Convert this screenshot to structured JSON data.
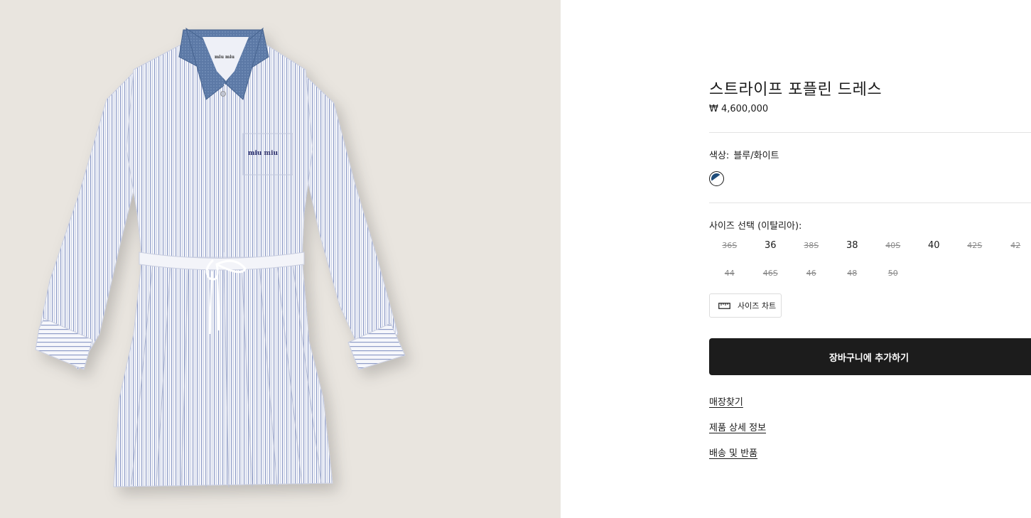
{
  "product": {
    "title": "스트라이프 포플린 드레스",
    "price": "₩ 4,600,000",
    "image_alt": "product-photo-striped-poplin-dress",
    "logo_text": "miu miu"
  },
  "color": {
    "label": "색상:",
    "value": "블루/화이트",
    "swatch_colors": [
      "#1e4d7b",
      "#ffffff"
    ]
  },
  "size": {
    "label": "사이즈 선택 (이탈리아):",
    "options": [
      {
        "label": "36S",
        "available": false
      },
      {
        "label": "36",
        "available": true
      },
      {
        "label": "38S",
        "available": false
      },
      {
        "label": "38",
        "available": true
      },
      {
        "label": "40S",
        "available": false
      },
      {
        "label": "40",
        "available": true
      },
      {
        "label": "42S",
        "available": false
      },
      {
        "label": "42",
        "available": false
      },
      {
        "label": "44",
        "available": false
      },
      {
        "label": "46S",
        "available": false
      },
      {
        "label": "46",
        "available": false
      },
      {
        "label": "48",
        "available": false
      },
      {
        "label": "50",
        "available": false
      }
    ],
    "chart_button": "사이즈 차트",
    "chart_icon": "ruler-icon"
  },
  "cart": {
    "add_label": "장바구니에 추가하기"
  },
  "links": {
    "store": "매장찾기",
    "details": "제품 상세 정보",
    "shipping": "배송 및 반품"
  },
  "colors": {
    "image_bg": "#e9e5df",
    "button_bg": "#1c1c1c",
    "collar": "#5b79a6",
    "stripe": "#8e9cc7"
  }
}
